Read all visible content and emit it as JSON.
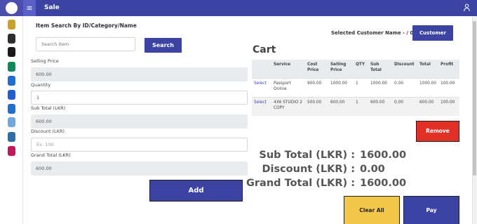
{
  "header": {
    "title": "Sale",
    "menu_icon": "hamburger-icon",
    "user_icon": "user-icon"
  },
  "sidebar": {
    "items": [
      {
        "icon": "passport-icon",
        "color": "#c9a227"
      },
      {
        "icon": "people-icon",
        "color": "#2e2e2e"
      },
      {
        "icon": "print-icon",
        "color": "#1a1a1a"
      },
      {
        "icon": "camera-icon",
        "color": "#0d8a5a"
      },
      {
        "icon": "user-icon",
        "color": "#1f6fd1"
      },
      {
        "icon": "document-icon",
        "color": "#1f5fd1"
      },
      {
        "icon": "info-icon",
        "color": "#1f6fd1"
      },
      {
        "icon": "clock-icon",
        "color": "#6fa9e0"
      },
      {
        "icon": "users-icon",
        "color": "#2a6fa8"
      },
      {
        "icon": "settings-icon",
        "color": "#c2185b"
      }
    ]
  },
  "search": {
    "heading": "Item Search By ID/Category/Name",
    "placeholder": "Search Item",
    "button_label": "Search"
  },
  "form": {
    "selling_price_label": "Selling Price",
    "selling_price_value": "600.00",
    "quantity_label": "Quantity",
    "quantity_value": "1",
    "subtotal_label": "Sub Total (LKR)",
    "subtotal_value": "600.00",
    "discount_label": "Discount (LKR)",
    "discount_placeholder": "Ex: 100",
    "grand_total_label": "Grand Total (LKR)",
    "grand_total_value": "600.00",
    "add_label": "Add"
  },
  "customer": {
    "selected_label": "Selected Customer Name - / 0",
    "button_label": "Customer"
  },
  "cart": {
    "title": "Cart",
    "columns": [
      "",
      "Service",
      "Cost Price",
      "Selling Price",
      "QTY",
      "Sub Total",
      "Discount",
      "Total",
      "Profit"
    ],
    "rows": [
      [
        "Select",
        "Passport Online",
        "900.00",
        "1000.00",
        "1",
        "1000.00",
        "0.00",
        "1000.00",
        "100.00"
      ],
      [
        "Select",
        "4X6 STUDIO 2 COPY",
        "500.00",
        "600.00",
        "1",
        "600.00",
        "0.00",
        "600.00",
        "100.00"
      ]
    ],
    "remove_label": "Remove"
  },
  "totals": {
    "subtotal_label": "Sub Total (LKR) :",
    "subtotal_value": "1600.00",
    "discount_label": "Discount (LKR) :",
    "discount_value": "0.00",
    "grand_label": "Grand Total (LKR) :",
    "grand_value": "1600.00"
  },
  "actions": {
    "clear_label": "Clear All",
    "pay_label": "Pay"
  },
  "colors": {
    "primary": "#3d43a3",
    "danger": "#e33027",
    "warning": "#f3c84a"
  }
}
